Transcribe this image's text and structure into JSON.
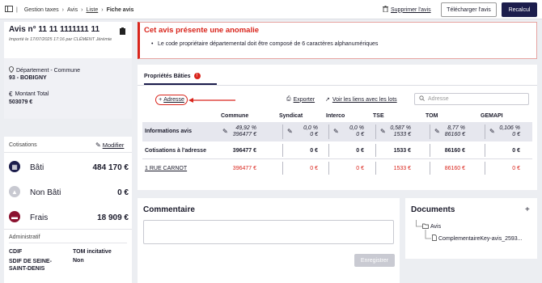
{
  "breadcrumb": {
    "root": "Gestion taxes",
    "items": [
      "Avis",
      "Liste",
      "Fiche avis"
    ]
  },
  "toolbar": {
    "delete": "Supprimer l'avis",
    "download": "Télécharger l'avis",
    "recalc": "Recalcul"
  },
  "avis": {
    "title": "Avis n° 11 11 1111111 11",
    "imported": "Importé le 17/07/2025 17:16 par CLÉMENT Jérémie",
    "dept_label": "Département - Commune",
    "dept_value": "93 - BOBIGNY",
    "amount_label": "Montant Total",
    "amount_value": "503079 €"
  },
  "cotisations": {
    "title": "Cotisations",
    "edit": "Modifier",
    "items": [
      {
        "label": "Bâti",
        "value": "484 170 €"
      },
      {
        "label": "Non Bâti",
        "value": "0 €"
      },
      {
        "label": "Frais",
        "value": "18 909 €"
      }
    ]
  },
  "admin": {
    "title": "Administratif",
    "cdif_label": "CDIF",
    "cdif_value": "SDIF DE SEINE-SAINT-DENIS",
    "tom_label": "TOM incitative",
    "tom_value": "Non"
  },
  "alert": {
    "title": "Cet avis présente une anomalie",
    "message": "Le code propriétaire départemental doit être composé de 6 caractères alphanumériques"
  },
  "props": {
    "tab": "Propriétés Bâties",
    "tab_badge": "!",
    "add": "Adresse",
    "export": "Exporter",
    "links": "Voir les liens avec les lots",
    "search_placeholder": "Adresse",
    "columns": [
      "Commune",
      "Syndicat",
      "Interco",
      "TSE",
      "TOM",
      "GEMAPI"
    ],
    "info_label": "Informations avis",
    "info_values": [
      {
        "pct": "49,92 %",
        "amt": "396477 €"
      },
      {
        "pct": "0,0 %",
        "amt": "0 €"
      },
      {
        "pct": "0,0 %",
        "amt": "0 €"
      },
      {
        "pct": "0,587 %",
        "amt": "1533 €"
      },
      {
        "pct": "8,77 %",
        "amt": "86160 €"
      },
      {
        "pct": "0,106 %",
        "amt": "0 €"
      }
    ],
    "cot_label": "Cotisations à l'adresse",
    "cot_values": [
      "396477 €",
      "0 €",
      "0 €",
      "1533 €",
      "86160 €",
      "0 €"
    ],
    "addr_label": "1 RUE CARNOT",
    "addr_values": [
      "396477 €",
      "0 €",
      "0 €",
      "1533 €",
      "86160 €",
      "0 €"
    ]
  },
  "comment": {
    "title": "Commentaire",
    "save": "Enregistrer"
  },
  "documents": {
    "title": "Documents",
    "add": "+",
    "folder": "Avis",
    "file": "ComplementaireKey-avis_2593..."
  },
  "colors": {
    "accent": "#d9251c",
    "navy": "#1c1d4c",
    "maroon": "#8b1230"
  }
}
